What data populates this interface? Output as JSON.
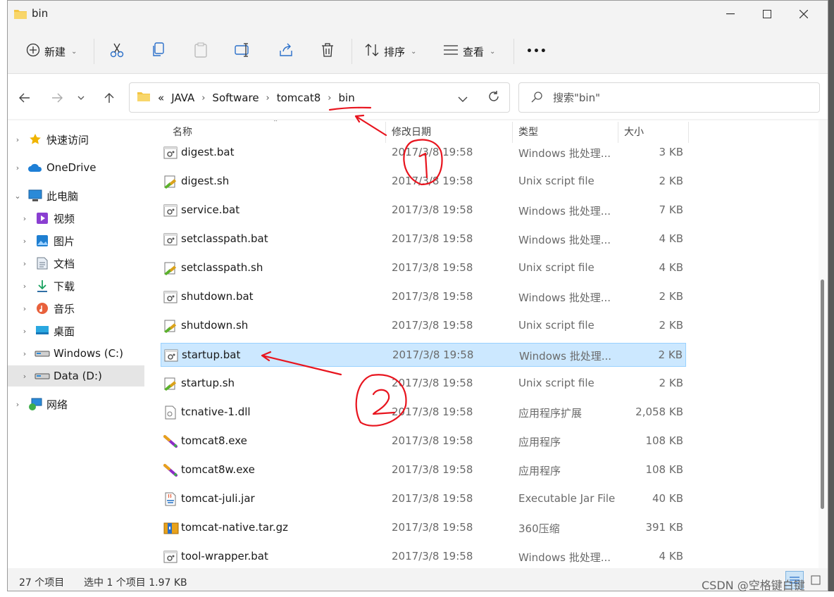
{
  "window": {
    "title": "bin"
  },
  "toolbar": {
    "new_label": "新建",
    "sort_label": "排序",
    "view_label": "查看",
    "more_label": "•••"
  },
  "breadcrumb": {
    "overflow": "«",
    "items": [
      "JAVA",
      "Software",
      "tomcat8",
      "bin"
    ]
  },
  "search": {
    "placeholder": "搜索\"bin\""
  },
  "sidebar": {
    "items": [
      {
        "label": "快速访问",
        "icon": "star-icon"
      },
      {
        "label": "OneDrive",
        "icon": "cloud-icon"
      },
      {
        "label": "此电脑",
        "icon": "computer-icon"
      },
      {
        "label": "视频",
        "icon": "video-icon"
      },
      {
        "label": "图片",
        "icon": "picture-icon"
      },
      {
        "label": "文档",
        "icon": "document-icon"
      },
      {
        "label": "下载",
        "icon": "download-icon"
      },
      {
        "label": "音乐",
        "icon": "music-icon"
      },
      {
        "label": "桌面",
        "icon": "desktop-icon"
      },
      {
        "label": "Windows (C:)",
        "icon": "drive-icon"
      },
      {
        "label": "Data (D:)",
        "icon": "drive-icon"
      },
      {
        "label": "网络",
        "icon": "network-icon"
      }
    ]
  },
  "columns": {
    "name": "名称",
    "date": "修改日期",
    "type": "类型",
    "size": "大小"
  },
  "files": [
    {
      "name": "digest.bat",
      "date": "2017/3/8 19:58",
      "type": "Windows 批处理...",
      "size": "3 KB",
      "icon": "bat"
    },
    {
      "name": "digest.sh",
      "date": "2017/3/8 19:58",
      "type": "Unix script file",
      "size": "2 KB",
      "icon": "sh"
    },
    {
      "name": "service.bat",
      "date": "2017/3/8 19:58",
      "type": "Windows 批处理...",
      "size": "7 KB",
      "icon": "bat"
    },
    {
      "name": "setclasspath.bat",
      "date": "2017/3/8 19:58",
      "type": "Windows 批处理...",
      "size": "4 KB",
      "icon": "bat"
    },
    {
      "name": "setclasspath.sh",
      "date": "2017/3/8 19:58",
      "type": "Unix script file",
      "size": "4 KB",
      "icon": "sh"
    },
    {
      "name": "shutdown.bat",
      "date": "2017/3/8 19:58",
      "type": "Windows 批处理...",
      "size": "2 KB",
      "icon": "bat"
    },
    {
      "name": "shutdown.sh",
      "date": "2017/3/8 19:58",
      "type": "Unix script file",
      "size": "2 KB",
      "icon": "sh"
    },
    {
      "name": "startup.bat",
      "date": "2017/3/8 19:58",
      "type": "Windows 批处理...",
      "size": "2 KB",
      "icon": "bat"
    },
    {
      "name": "startup.sh",
      "date": "2017/3/8 19:58",
      "type": "Unix script file",
      "size": "2 KB",
      "icon": "sh"
    },
    {
      "name": "tcnative-1.dll",
      "date": "2017/3/8 19:58",
      "type": "应用程序扩展",
      "size": "2,058 KB",
      "icon": "dll"
    },
    {
      "name": "tomcat8.exe",
      "date": "2017/3/8 19:58",
      "type": "应用程序",
      "size": "108 KB",
      "icon": "exe"
    },
    {
      "name": "tomcat8w.exe",
      "date": "2017/3/8 19:58",
      "type": "应用程序",
      "size": "108 KB",
      "icon": "exe"
    },
    {
      "name": "tomcat-juli.jar",
      "date": "2017/3/8 19:58",
      "type": "Executable Jar File",
      "size": "40 KB",
      "icon": "jar"
    },
    {
      "name": "tomcat-native.tar.gz",
      "date": "2017/3/8 19:58",
      "type": "360压缩",
      "size": "391 KB",
      "icon": "zip"
    },
    {
      "name": "tool-wrapper.bat",
      "date": "2017/3/8 19:58",
      "type": "Windows 批处理...",
      "size": "4 KB",
      "icon": "bat"
    }
  ],
  "selected_file": "startup.bat",
  "status": {
    "count": "27 个项目",
    "selection": "选中 1 个项目  1.97 KB"
  },
  "watermark": "CSDN @空格键白键",
  "colors": {
    "selection": "#cce8ff",
    "selection_border": "#99d1ff",
    "annotation": "#e8141e",
    "folder": "#f4c542"
  }
}
